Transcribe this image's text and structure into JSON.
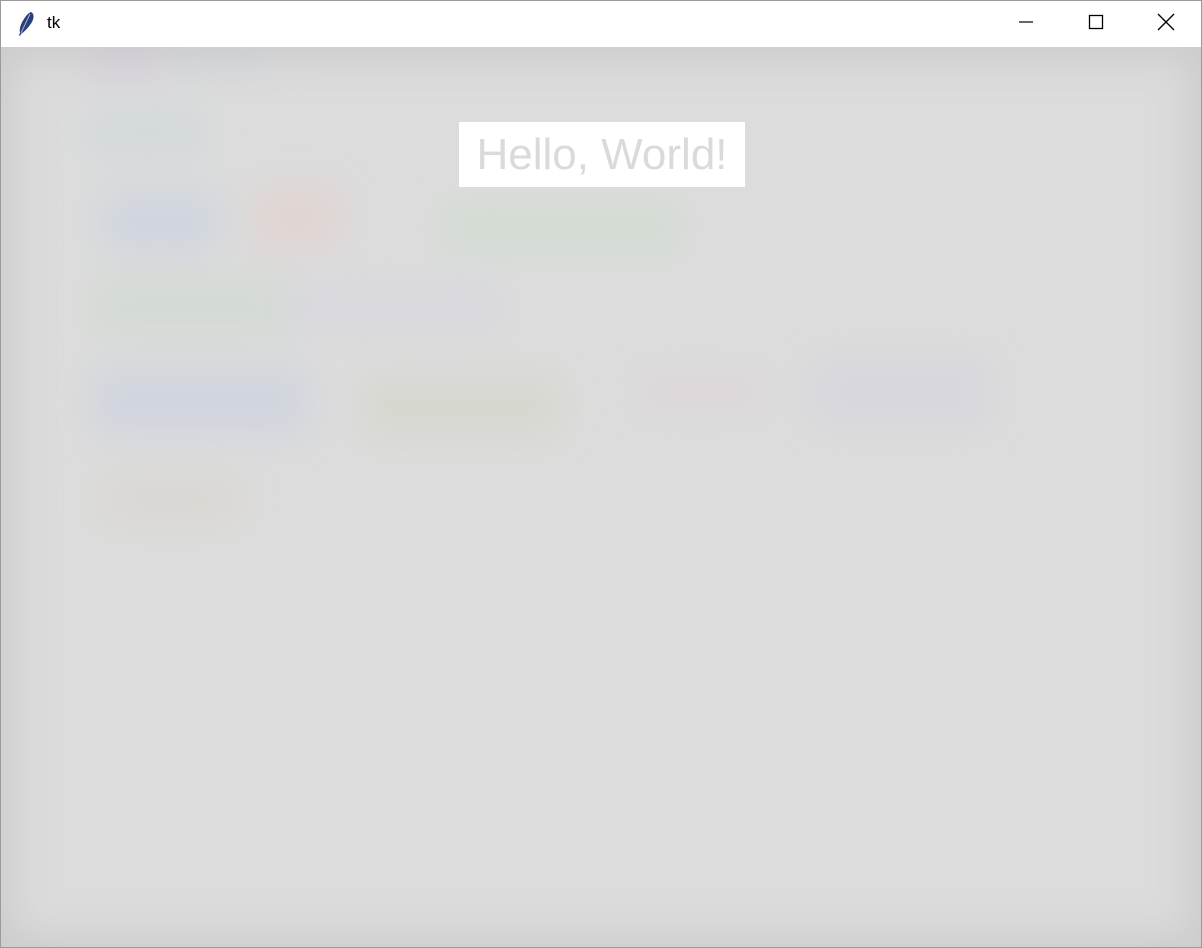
{
  "window": {
    "title": "tk",
    "app_icon": "tk-feather-icon",
    "controls": {
      "minimize_icon": "minimize-icon",
      "maximize_icon": "maximize-icon",
      "close_icon": "close-icon"
    }
  },
  "content": {
    "label_text": "Hello, World!",
    "label_background": "#ffffff",
    "label_text_color": "#dadada",
    "window_background": "#dcdcdc"
  }
}
